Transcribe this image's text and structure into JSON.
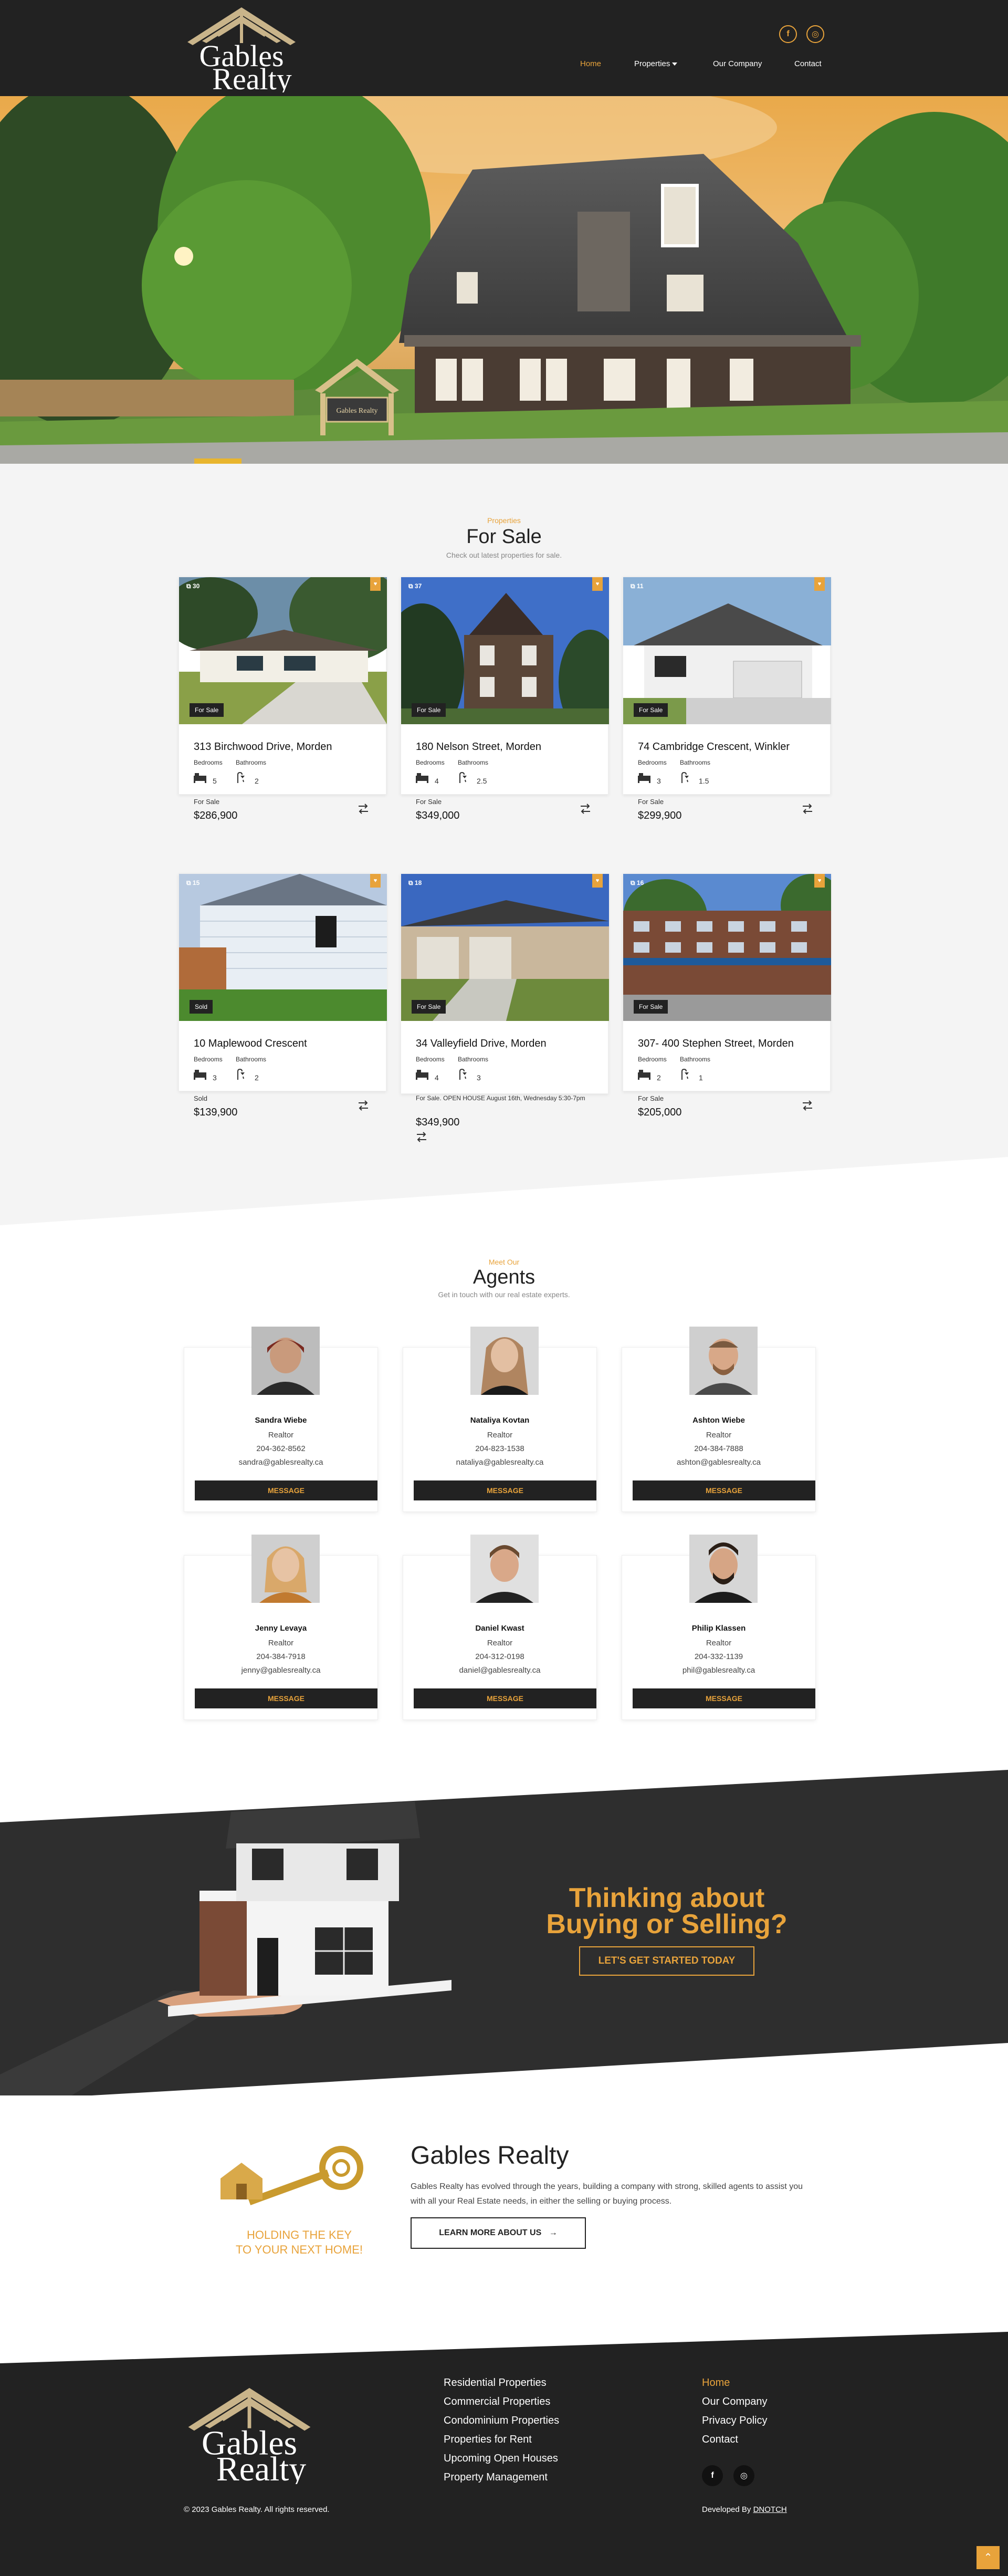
{
  "brand": {
    "name_line1": "Gables",
    "name_line2": "Realty",
    "accent": "#e8a33b",
    "dark": "#222222"
  },
  "header": {
    "social": [
      {
        "icon": "facebook-icon",
        "glyph": "f"
      },
      {
        "icon": "instagram-icon",
        "glyph": "◎"
      }
    ],
    "nav": [
      {
        "label": "Home",
        "active": true
      },
      {
        "label": "Properties",
        "dropdown": true
      },
      {
        "label": "Our Company"
      },
      {
        "label": "Contact"
      }
    ]
  },
  "hero": {
    "sign_text": "Gables Realty"
  },
  "for_sale": {
    "eyebrow": "Properties",
    "title": "For Sale",
    "subtitle": "Check out latest properties for sale.",
    "bedrooms_label": "Bedrooms",
    "bathrooms_label": "Bathrooms",
    "listings": [
      {
        "photo_count": "30",
        "badge": "For Sale",
        "address": "313 Birchwood Drive, Morden",
        "bedrooms": "5",
        "bathrooms": "2",
        "status": "For Sale",
        "price": "$286,900"
      },
      {
        "photo_count": "37",
        "badge": "For Sale",
        "address": "180 Nelson Street, Morden",
        "bedrooms": "4",
        "bathrooms": "2.5",
        "status": "For Sale",
        "price": "$349,000"
      },
      {
        "photo_count": "11",
        "badge": "For Sale",
        "address": "74 Cambridge Crescent, Winkler",
        "bedrooms": "3",
        "bathrooms": "1.5",
        "status": "For Sale",
        "price": "$299,900"
      },
      {
        "photo_count": "15",
        "badge": "Sold",
        "address": "10 Maplewood Crescent",
        "bedrooms": "3",
        "bathrooms": "2",
        "status": "Sold",
        "price": "$139,900"
      },
      {
        "photo_count": "18",
        "badge": "For Sale",
        "address": "34 Valleyfield Drive, Morden",
        "bedrooms": "4",
        "bathrooms": "3",
        "status": "For Sale. OPEN HOUSE August 16th, Wednesday 5:30-7pm",
        "price": "$349,900"
      },
      {
        "photo_count": "16",
        "badge": "For Sale",
        "address": "307- 400 Stephen Street, Morden",
        "bedrooms": "2",
        "bathrooms": "1",
        "status": "For Sale",
        "price": "$205,000"
      }
    ]
  },
  "agents": {
    "eyebrow": "Meet Our",
    "title": "Agents",
    "subtitle": "Get in touch with our real estate experts.",
    "button_label": "MESSAGE",
    "list": [
      {
        "name": "Sandra Wiebe",
        "role": "Realtor",
        "phone": "204-362-8562",
        "email": "sandra@gablesrealty.ca"
      },
      {
        "name": "Nataliya Kovtan",
        "role": "Realtor",
        "phone": "204-823-1538",
        "email": "nataliya@gablesrealty.ca"
      },
      {
        "name": "Ashton Wiebe",
        "role": "Realtor",
        "phone": "204-384-7888",
        "email": "ashton@gablesrealty.ca"
      },
      {
        "name": "Jenny Levaya",
        "role": "Realtor",
        "phone": "204-384-7918",
        "email": "jenny@gablesrealty.ca"
      },
      {
        "name": "Daniel Kwast",
        "role": "Realtor",
        "phone": "204-312-0198",
        "email": "daniel@gablesrealty.ca"
      },
      {
        "name": "Philip Klassen",
        "role": "Realtor",
        "phone": "204-332-1139",
        "email": "phil@gablesrealty.ca"
      }
    ]
  },
  "cta": {
    "line1": "Thinking about",
    "line2": "Buying or Selling?",
    "button": "LET'S GET STARTED TODAY"
  },
  "about": {
    "title": "Gables Realty",
    "text": "Gables Realty has evolved through the years, building a company with strong, skilled agents to assist you with all your Real Estate needs, in either the selling or buying process.",
    "button": "LEARN MORE ABOUT US",
    "tagline1": "HOLDING THE KEY",
    "tagline2": "TO YOUR NEXT HOME!"
  },
  "footer": {
    "services": [
      "Residential Properties",
      "Commercial Properties",
      "Condominium Properties",
      "Properties for Rent",
      "Upcoming Open Houses",
      "Property Management"
    ],
    "links": [
      {
        "label": "Home",
        "active": true
      },
      {
        "label": "Our Company"
      },
      {
        "label": "Privacy Policy"
      },
      {
        "label": "Contact"
      }
    ],
    "copyright": "© 2023 Gables Realty. All rights reserved.",
    "developed_prefix": "Developed By",
    "developer": "DNOTCH"
  }
}
